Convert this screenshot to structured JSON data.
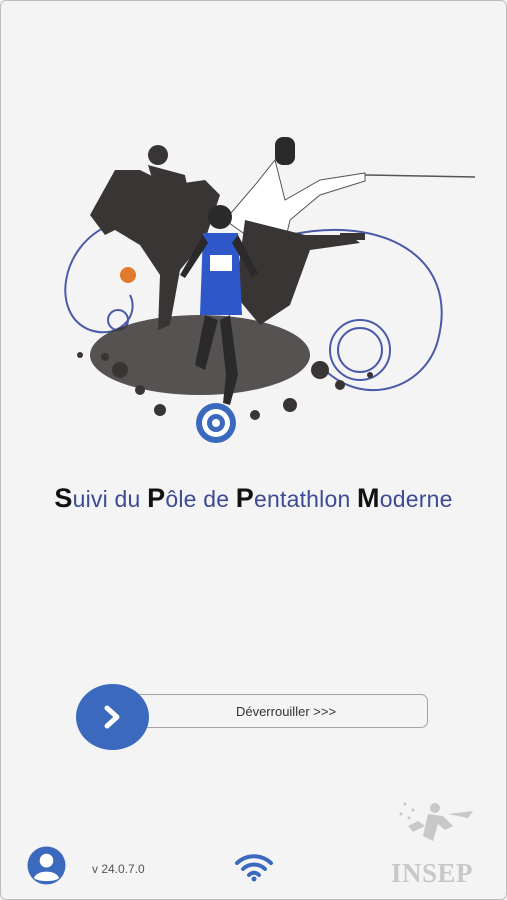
{
  "app": {
    "title_words": [
      {
        "cap": "S",
        "rest": "uivi du "
      },
      {
        "cap": "P",
        "rest": "ôle de "
      },
      {
        "cap": "P",
        "rest": "entathlon "
      },
      {
        "cap": "M",
        "rest": "oderne"
      }
    ]
  },
  "unlock": {
    "label": "Déverrouiller >>>",
    "icon": "chevron-right-icon"
  },
  "footer": {
    "avatar_icon": "user-icon",
    "version": "v 24.0.7.0",
    "network_icon": "wifi-icon",
    "logo_text": "INSEP"
  },
  "colors": {
    "accent": "#3a69bd",
    "title_text": "#3d4b95",
    "background": "#f4f4f4",
    "logo_gray": "#c8c8c8"
  }
}
